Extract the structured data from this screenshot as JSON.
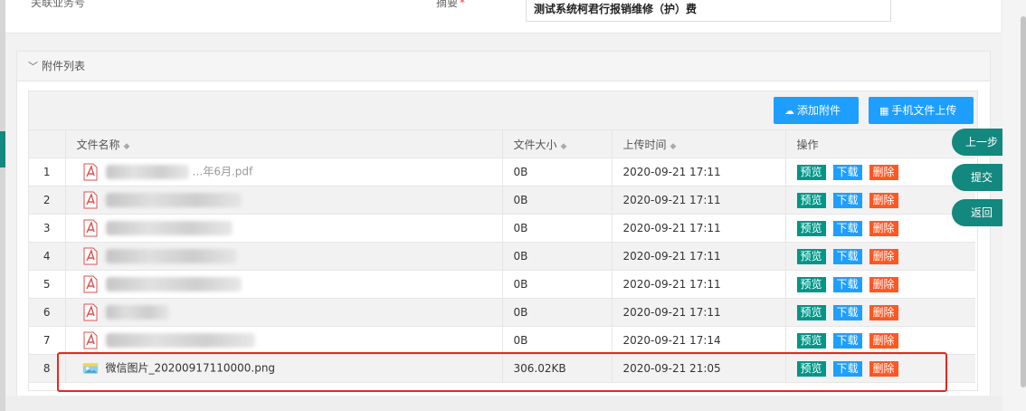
{
  "form": {
    "related_label": "关联业务号",
    "summary_label": "摘要",
    "summary_required": "*",
    "summary_value": "测试系统柯君行报销维修（护）费"
  },
  "panel": {
    "title": "附件列表",
    "add_attachment": "添加附件",
    "mobile_upload": "手机文件上传"
  },
  "table": {
    "headers": {
      "name": "文件名称",
      "size": "文件大小",
      "time": "上传时间",
      "ops": "操作"
    },
    "ops": {
      "preview": "预览",
      "download": "下载",
      "delete": "删除"
    },
    "rows": [
      {
        "no": "1",
        "name": "…年6月.pdf",
        "size": "0B",
        "time": "2020-09-21 17:11"
      },
      {
        "no": "2",
        "name": "",
        "size": "0B",
        "time": "2020-09-21 17:11"
      },
      {
        "no": "3",
        "name": "",
        "size": "0B",
        "time": "2020-09-21 17:11"
      },
      {
        "no": "4",
        "name": "",
        "size": "0B",
        "time": "2020-09-21 17:11"
      },
      {
        "no": "5",
        "name": "",
        "size": "0B",
        "time": "2020-09-21 17:11"
      },
      {
        "no": "6",
        "name": "",
        "size": "0B",
        "time": "2020-09-21 17:11"
      },
      {
        "no": "7",
        "name": "",
        "size": "0B",
        "time": "2020-09-21 17:14"
      },
      {
        "no": "8",
        "name": "微信图片_20200917110000.png",
        "size": "306.02KB",
        "time": "2020-09-21 21:05"
      }
    ]
  },
  "side_buttons": {
    "prev": "上一步",
    "submit": "提交",
    "back": "返回"
  },
  "colors": {
    "teal": "#13887e",
    "blue": "#1e9fff",
    "green": "#009688",
    "orange": "#ff5722",
    "highlight": "#e8281f"
  }
}
